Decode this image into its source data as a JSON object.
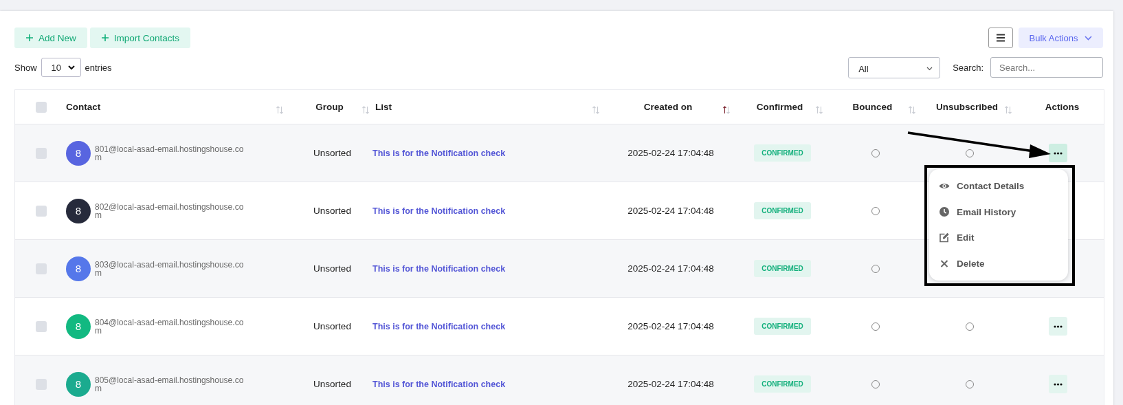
{
  "toolbar": {
    "buttons": [
      {
        "label": "Add New"
      },
      {
        "label": "Import Contacts"
      }
    ],
    "bulk_actions": {
      "label": "Bulk Actions"
    }
  },
  "length_menu": {
    "before": "Show",
    "value": "10",
    "after": "entries"
  },
  "filter": {
    "value": "All"
  },
  "search": {
    "label": "Search:",
    "placeholder": "Search..."
  },
  "table": {
    "select_all": {
      "checked": false
    },
    "columns": [
      {
        "label": "Contact",
        "sorted": false
      },
      {
        "label": "Group",
        "sorted": false
      },
      {
        "label": "List",
        "sorted": false
      },
      {
        "label": "Created on",
        "sorted": true
      },
      {
        "label": "Confirmed",
        "sorted": false
      },
      {
        "label": "Bounced",
        "sorted": false
      },
      {
        "label": "Unsubscribed",
        "sorted": false
      },
      {
        "label": "Actions"
      }
    ],
    "rows": [
      {
        "checked": false,
        "initial": "8",
        "color": "#5865e0",
        "email": "801@local-asad-email.hostingshouse.com",
        "group": "Unsorted",
        "list": "This is for the Notification check",
        "created": "2025-02-24 17:04:48",
        "status": "CONFIRMED",
        "bounced": false,
        "unsubscribed": false,
        "menu_open": true
      },
      {
        "checked": false,
        "initial": "8",
        "color": "#262a3b",
        "email": "802@local-asad-email.hostingshouse.com",
        "group": "Unsorted",
        "list": "This is for the Notification check",
        "created": "2025-02-24 17:04:48",
        "status": "CONFIRMED",
        "bounced": false
      },
      {
        "checked": false,
        "initial": "8",
        "color": "#5577ea",
        "email": "803@local-asad-email.hostingshouse.com",
        "group": "Unsorted",
        "list": "This is for the Notification check",
        "created": "2025-02-24 17:04:48",
        "status": "CONFIRMED",
        "bounced": false
      },
      {
        "checked": false,
        "initial": "8",
        "color": "#12b981",
        "email": "804@local-asad-email.hostingshouse.com",
        "group": "Unsorted",
        "list": "This is for the Notification check",
        "created": "2025-02-24 17:04:48",
        "status": "CONFIRMED",
        "bounced": false,
        "unsubscribed": false,
        "menu_open": false
      },
      {
        "checked": false,
        "initial": "8",
        "color": "#1bab8f",
        "email": "805@local-asad-email.hostingshouse.com",
        "group": "Unsorted",
        "list": "This is for the Notification check",
        "created": "2025-02-24 17:04:48",
        "status": "CONFIRMED",
        "bounced": false,
        "unsubscribed": false,
        "menu_open": false
      }
    ]
  },
  "action_menu": {
    "items": [
      {
        "kind": "view",
        "label": "Contact Details"
      },
      {
        "kind": "history",
        "label": "Email History"
      },
      {
        "kind": "edit",
        "label": "Edit"
      },
      {
        "kind": "delete",
        "label": "Delete"
      }
    ]
  }
}
